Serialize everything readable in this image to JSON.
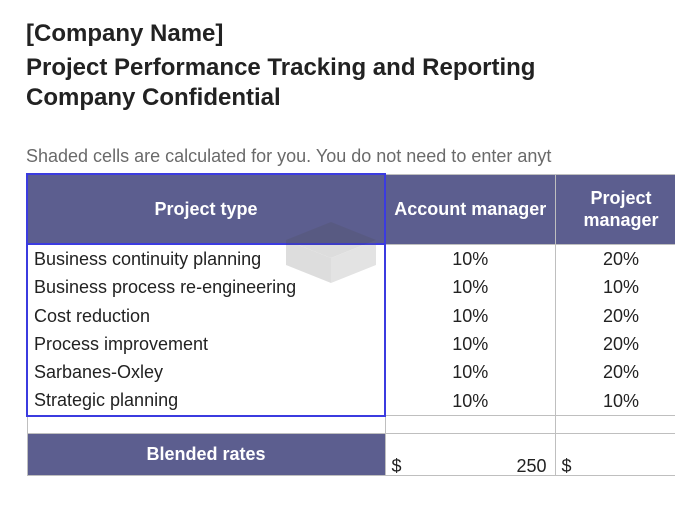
{
  "header": {
    "company_name": "[Company Name]",
    "title1": "Project Performance Tracking and Reporting",
    "title2": "Company Confidential"
  },
  "instruction": "Shaded cells are calculated for you.  You do not need to enter anyt",
  "table": {
    "columns": {
      "project_type": "Project type",
      "account_manager": "Account manager",
      "project_manager": "Project manager"
    },
    "rows": [
      {
        "type": "Business continuity planning",
        "account_manager": "10%",
        "project_manager": "20%"
      },
      {
        "type": "Business process re-engineering",
        "account_manager": "10%",
        "project_manager": "10%"
      },
      {
        "type": "Cost reduction",
        "account_manager": "10%",
        "project_manager": "20%"
      },
      {
        "type": "Process improvement",
        "account_manager": "10%",
        "project_manager": "20%"
      },
      {
        "type": "Sarbanes-Oxley",
        "account_manager": "10%",
        "project_manager": "20%"
      },
      {
        "type": "Strategic planning",
        "account_manager": "10%",
        "project_manager": "10%"
      }
    ],
    "blended": {
      "label": "Blended rates",
      "account_manager_symbol": "$",
      "account_manager_value": "250",
      "project_manager_symbol": "$",
      "project_manager_value": ""
    }
  }
}
